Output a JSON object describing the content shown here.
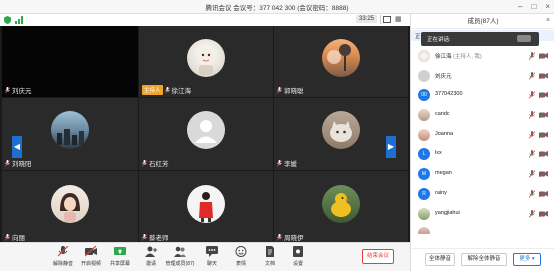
{
  "window": {
    "title": "腾讯会议  会议号：377 042 300  (会议密码：8888)"
  },
  "stage": {
    "time": "33:25",
    "tiles": [
      {
        "name": "刘庆元",
        "host": false,
        "avatar": "none"
      },
      {
        "name": "徐江海",
        "host": true,
        "host_label": "主持人",
        "avatar": "cartoon"
      },
      {
        "name": "郭晓聪",
        "host": false,
        "avatar": "sky"
      },
      {
        "name": "刘晓阳",
        "host": false,
        "avatar": "city"
      },
      {
        "name": "石红芳",
        "host": false,
        "avatar": "default"
      },
      {
        "name": "李媛",
        "host": false,
        "avatar": "cat"
      },
      {
        "name": "向丽",
        "host": false,
        "avatar": "girl"
      },
      {
        "name": "蔡老师",
        "host": false,
        "avatar": "red"
      },
      {
        "name": "周晓伊",
        "host": false,
        "avatar": "duck"
      }
    ]
  },
  "toolbar": {
    "items": [
      {
        "label": "解除静音",
        "icon": "mic-muted-icon"
      },
      {
        "label": "开启视频",
        "icon": "camera-off-icon"
      },
      {
        "label": "共享屏幕",
        "icon": "share-screen-icon"
      },
      {
        "label": "邀请",
        "icon": "invite-icon"
      },
      {
        "label": "管理成员(87)",
        "icon": "members-icon"
      },
      {
        "label": "聊天",
        "icon": "chat-icon"
      },
      {
        "label": "表情",
        "icon": "emoji-icon"
      },
      {
        "label": "文档",
        "icon": "document-icon"
      },
      {
        "label": "设置",
        "icon": "settings-icon"
      }
    ],
    "end_label": "结束会议"
  },
  "panel": {
    "title": "成员(87人)",
    "speaking_label": "正在讲话:",
    "tip_label": "正在讲话:",
    "members": [
      {
        "name": "徐江海",
        "role": "(主持人, 我)",
        "avatar": "cartoon"
      },
      {
        "name": "刘庆元",
        "role": "",
        "avatar": "gray"
      },
      {
        "name": "377042300",
        "role": "",
        "avatar": "letter",
        "letter": "00"
      },
      {
        "name": "candc",
        "role": "",
        "avatar": "photo"
      },
      {
        "name": "Joanna",
        "role": "",
        "avatar": "photo2"
      },
      {
        "name": "lxx",
        "role": "",
        "avatar": "letter",
        "letter": "L"
      },
      {
        "name": "megan",
        "role": "",
        "avatar": "letter",
        "letter": "M"
      },
      {
        "name": "rainy",
        "role": "",
        "avatar": "letter",
        "letter": "R"
      },
      {
        "name": "yangjiahui",
        "role": "",
        "avatar": "photo3"
      },
      {
        "name": "",
        "role": "",
        "avatar": "photo4"
      }
    ],
    "buttons": {
      "mute_all": "全体静音",
      "unmute_all": "解除全体静音",
      "more": "更多"
    }
  },
  "colors": {
    "accent": "#1e78e8",
    "host_badge": "#f0a42c",
    "end_meeting": "#e04040",
    "tile_bg": "#2a2a2a"
  }
}
